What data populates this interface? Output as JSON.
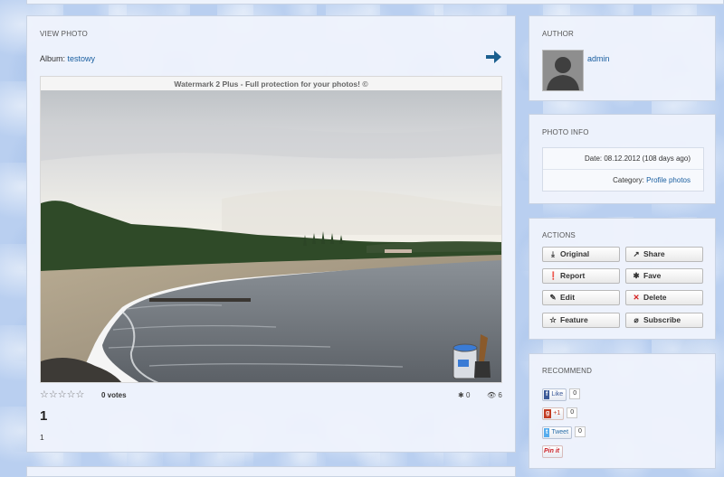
{
  "main": {
    "section_title": "VIEW PHOTO",
    "album_label": "Album:",
    "album_name": "testowy",
    "watermark": "Watermark 2 Plus - Full protection for your photos!  ©",
    "rating": {
      "stars": 0,
      "max_stars": 5,
      "votes_label": "0 votes"
    },
    "fave_count": "0",
    "view_count": "6",
    "photo_title": "1",
    "photo_description": "1"
  },
  "author": {
    "section_title": "AUTHOR",
    "name": "admin"
  },
  "photo_info": {
    "section_title": "PHOTO INFO",
    "date_label": "Date:",
    "date_value": "08.12.2012 (108 days ago)",
    "category_label": "Category:",
    "category_value": "Profile photos"
  },
  "actions": {
    "section_title": "ACTIONS",
    "buttons": [
      {
        "label": "Original",
        "icon": "download-icon"
      },
      {
        "label": "Share",
        "icon": "share-icon"
      },
      {
        "label": "Report",
        "icon": "exclamation-icon"
      },
      {
        "label": "Fave",
        "icon": "asterisk-icon"
      },
      {
        "label": "Edit",
        "icon": "edit-icon"
      },
      {
        "label": "Delete",
        "icon": "x-icon"
      },
      {
        "label": "Feature",
        "icon": "star-icon"
      },
      {
        "label": "Subscribe",
        "icon": "paperclip-icon"
      }
    ]
  },
  "recommend": {
    "section_title": "RECOMMEND",
    "facebook_label": "Like",
    "facebook_count": "0",
    "google_label": "+1",
    "google_count": "0",
    "twitter_label": "Tweet",
    "twitter_count": "0",
    "pinterest_label": "Pin it"
  },
  "colors": {
    "link": "#1a5fa0",
    "arrow": "#1a5f8f",
    "delete": "#d42020",
    "background": "#b9cff0"
  }
}
